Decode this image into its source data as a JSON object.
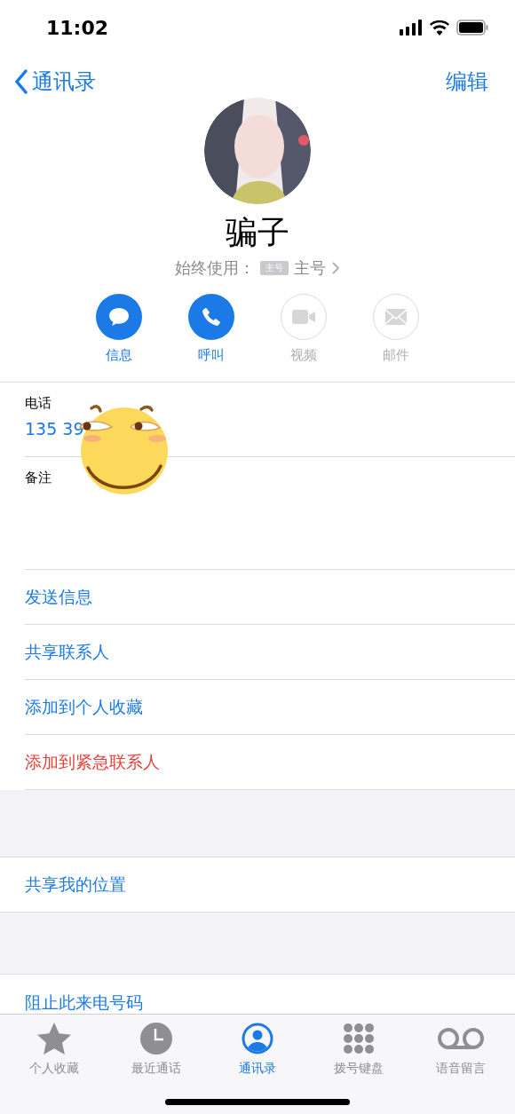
{
  "status_bar": {
    "time": "11:02"
  },
  "nav": {
    "back": "通讯录",
    "edit": "编辑"
  },
  "contact": {
    "name": "骗子",
    "subtitle": "始终使用：",
    "sim_badge": "主号",
    "line": "主号"
  },
  "actions": [
    {
      "kind": "message",
      "label": "信息",
      "disabled": false
    },
    {
      "kind": "call",
      "label": "呼叫",
      "disabled": false
    },
    {
      "kind": "video",
      "label": "视频",
      "disabled": true
    },
    {
      "kind": "mail",
      "label": "邮件",
      "disabled": true
    }
  ],
  "phone": {
    "label": "电话",
    "value": "135 39"
  },
  "notes": {
    "label": "备注"
  },
  "links": [
    {
      "label": "发送信息",
      "destructive": false
    },
    {
      "label": "共享联系人",
      "destructive": false
    },
    {
      "label": "添加到个人收藏",
      "destructive": false
    },
    {
      "label": "添加到紧急联系人",
      "destructive": true
    }
  ],
  "location": {
    "label": "共享我的位置"
  },
  "block": {
    "label": "阻止此来电号码"
  },
  "tabs": [
    {
      "kind": "star",
      "label": "个人收藏",
      "selected": false
    },
    {
      "kind": "clock",
      "label": "最近通话",
      "selected": false
    },
    {
      "kind": "person",
      "label": "通讯录",
      "selected": true
    },
    {
      "kind": "keypad",
      "label": "拨号键盘",
      "selected": false
    },
    {
      "kind": "voicemail",
      "label": "语音留言",
      "selected": false
    }
  ]
}
